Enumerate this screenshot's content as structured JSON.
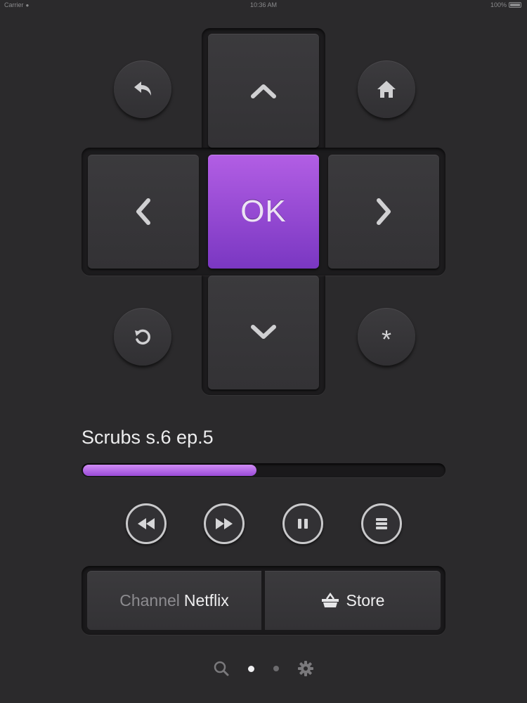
{
  "status_bar": {
    "carrier": "Carrier",
    "time": "10:36 AM",
    "battery": "100%"
  },
  "dpad": {
    "ok_label": "OK",
    "up_icon": "chevron-up-icon",
    "down_icon": "chevron-down-icon",
    "left_icon": "chevron-left-icon",
    "right_icon": "chevron-right-icon"
  },
  "round_buttons": {
    "back_icon": "back-arrow-icon",
    "home_icon": "home-icon",
    "replay_icon": "replay-icon",
    "options_label": "*"
  },
  "now_playing": {
    "title": "Scrubs s.6 ep.5",
    "progress_percent": 48
  },
  "transport": {
    "icons": [
      "rewind-icon",
      "fast-forward-icon",
      "pause-icon",
      "menu-icon"
    ]
  },
  "bottom_bar": {
    "channel_prefix": "Channel",
    "channel_name": "Netflix",
    "store_label": "Store",
    "store_icon": "basket-icon"
  },
  "page_indicator": {
    "items": [
      "search-icon",
      "page-dot-active",
      "page-dot",
      "gear-icon"
    ]
  },
  "colors": {
    "background": "#2b2a2c",
    "accent": "#9a4bd8",
    "ok_top": "#b25ee4",
    "ok_bottom": "#7a37c2"
  }
}
